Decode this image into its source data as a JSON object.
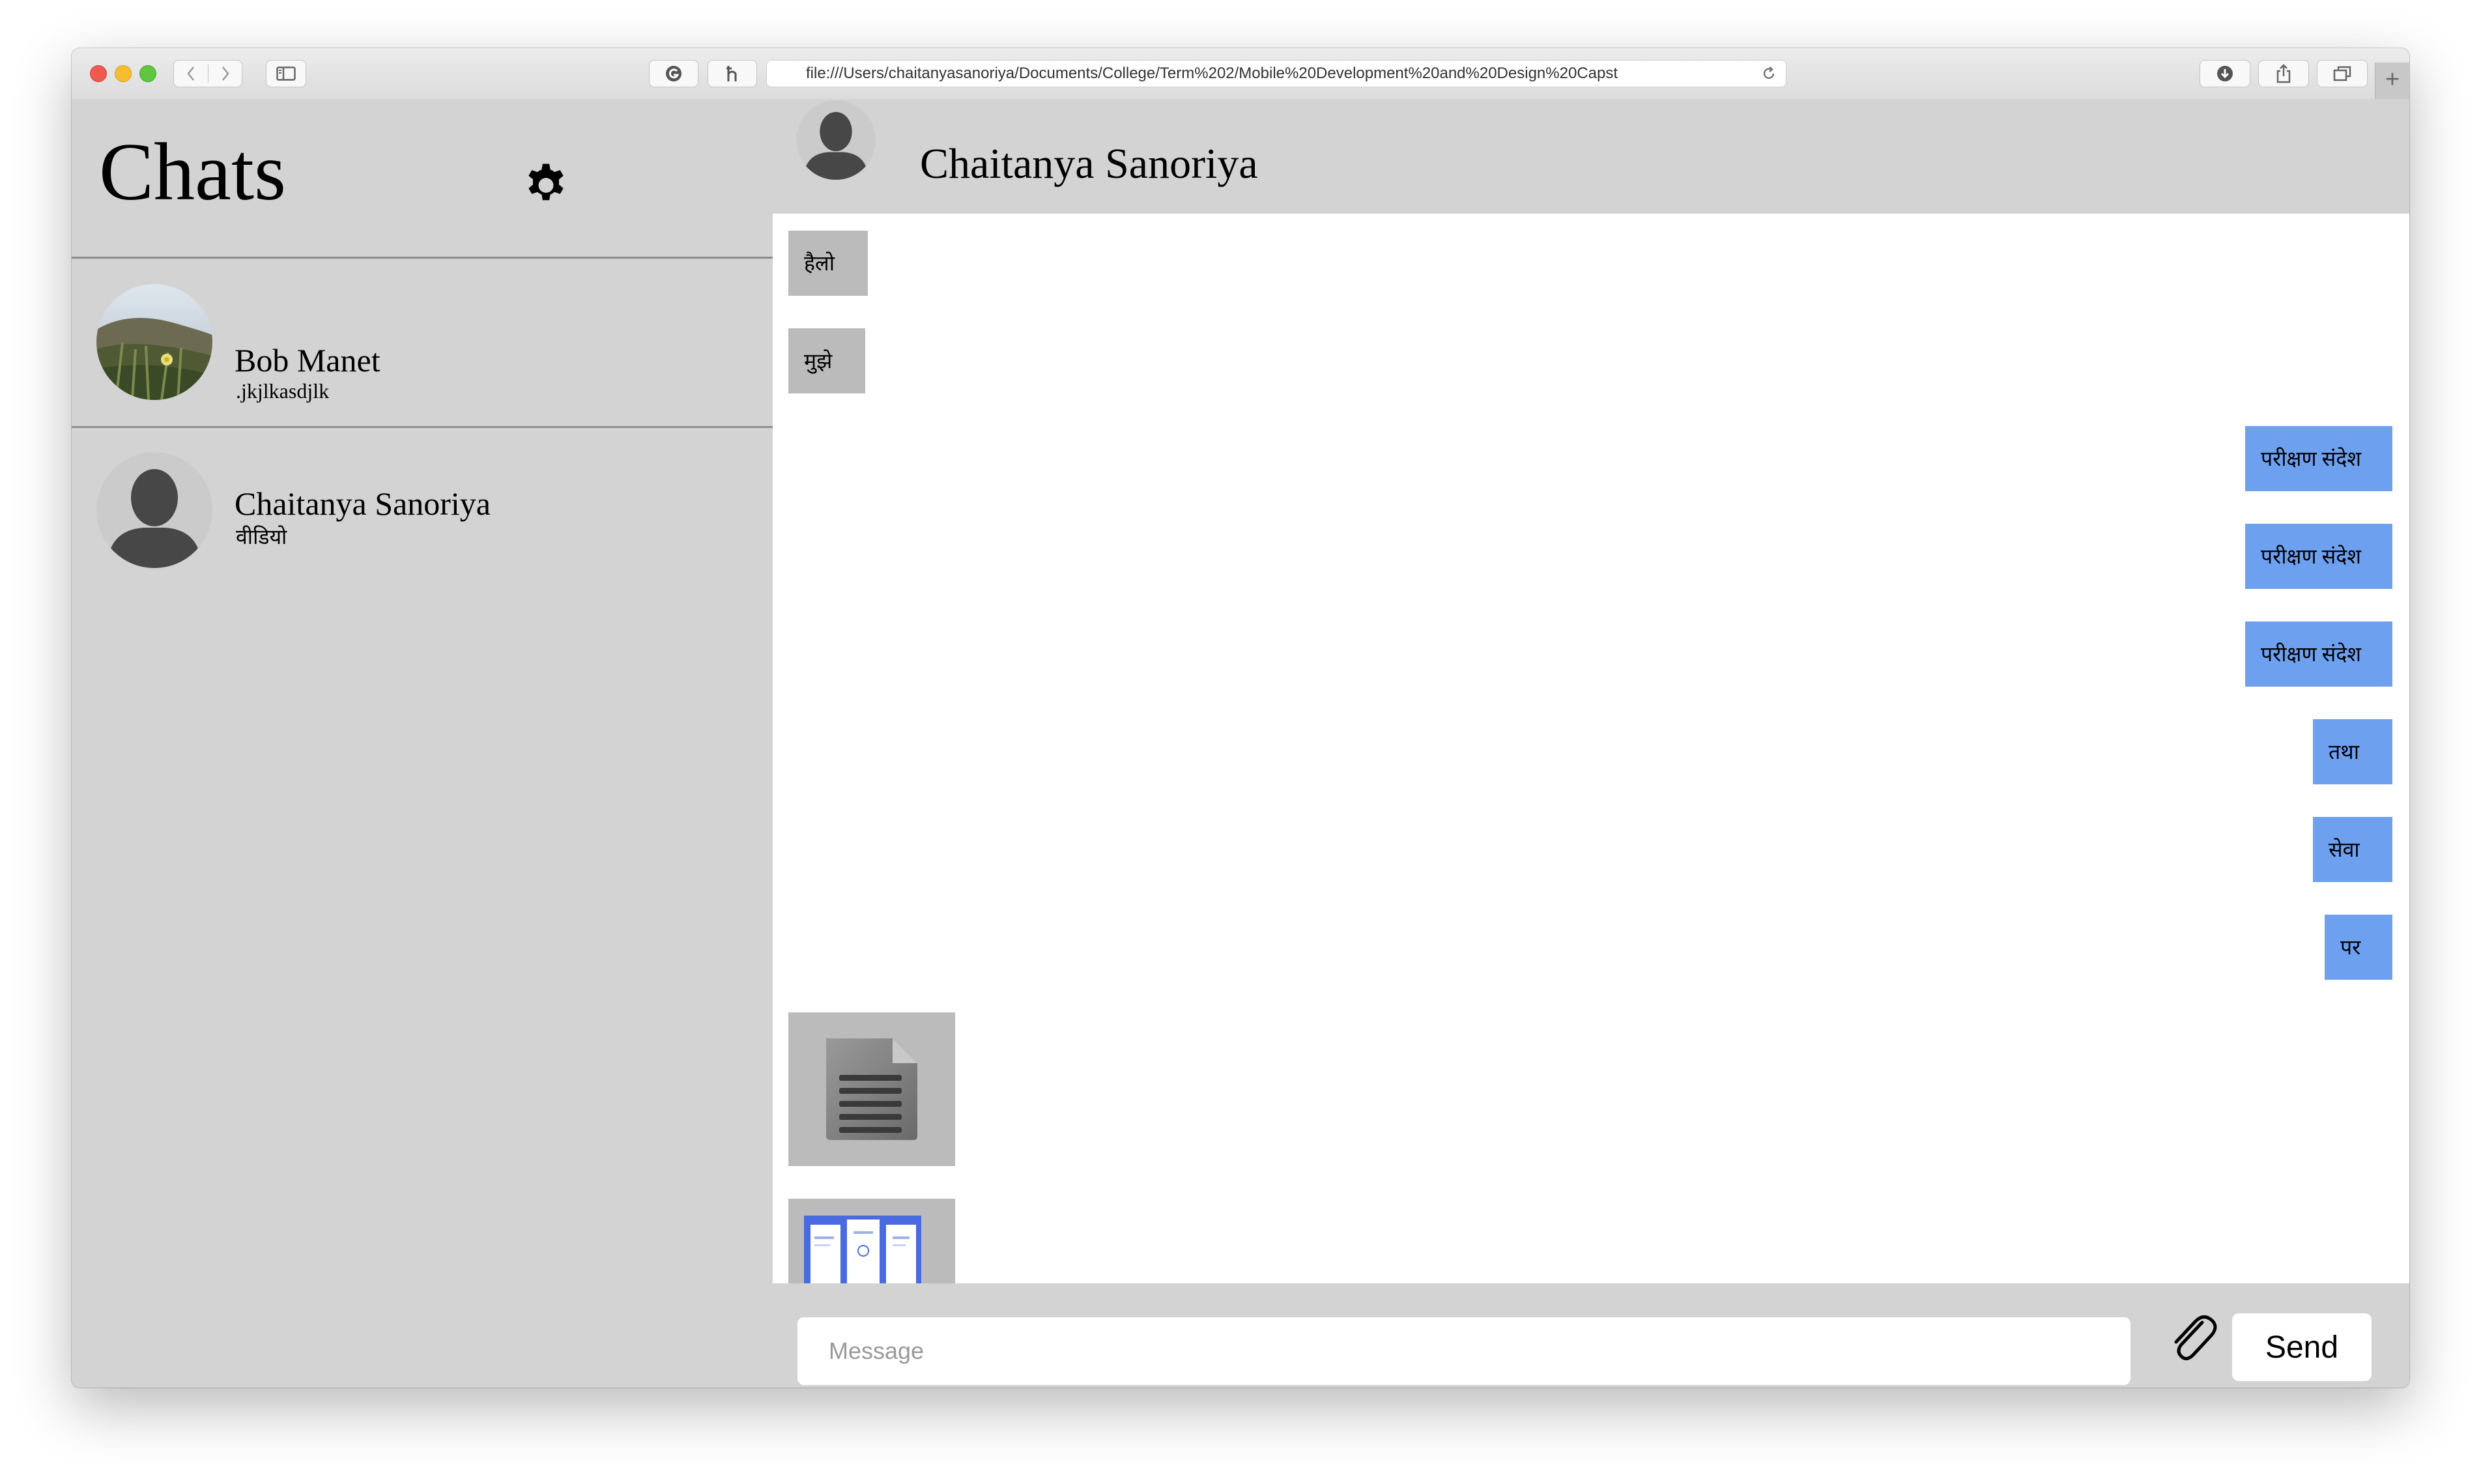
{
  "browser": {
    "url": "file:///Users/chaitanyasanoriya/Documents/College/Term%202/Mobile%20Development%20and%20Design%20Capst",
    "new_tab_label": "+"
  },
  "sidebar": {
    "title": "Chats",
    "contacts": [
      {
        "name": "Bob Manet",
        "preview": ".jkjlkasdjlk",
        "avatar": "photo-avatar"
      },
      {
        "name": "Chaitanya Sanoriya",
        "preview": "वीडियो",
        "avatar": "default-avatar"
      }
    ]
  },
  "chat": {
    "contact_name": "Chaitanya Sanoriya",
    "messages": [
      {
        "text": "हैलो",
        "direction": "incoming"
      },
      {
        "text": "मुझे",
        "direction": "incoming"
      },
      {
        "text": "परीक्षण संदेश",
        "direction": "outgoing"
      },
      {
        "text": "परीक्षण संदेश",
        "direction": "outgoing"
      },
      {
        "text": "परीक्षण संदेश",
        "direction": "outgoing"
      },
      {
        "text": "तथा",
        "direction": "outgoing"
      },
      {
        "text": "सेवा",
        "direction": "outgoing"
      },
      {
        "text": "पर",
        "direction": "outgoing"
      },
      {
        "type": "document-attachment",
        "direction": "incoming"
      },
      {
        "type": "image-attachment",
        "direction": "incoming"
      }
    ]
  },
  "composer": {
    "placeholder": "Message",
    "send_label": "Send"
  },
  "colors": {
    "incoming_bubble": "#bbbbbb",
    "outgoing_bubble": "#6ea0f0",
    "panel_bg": "#d3d3d3"
  }
}
